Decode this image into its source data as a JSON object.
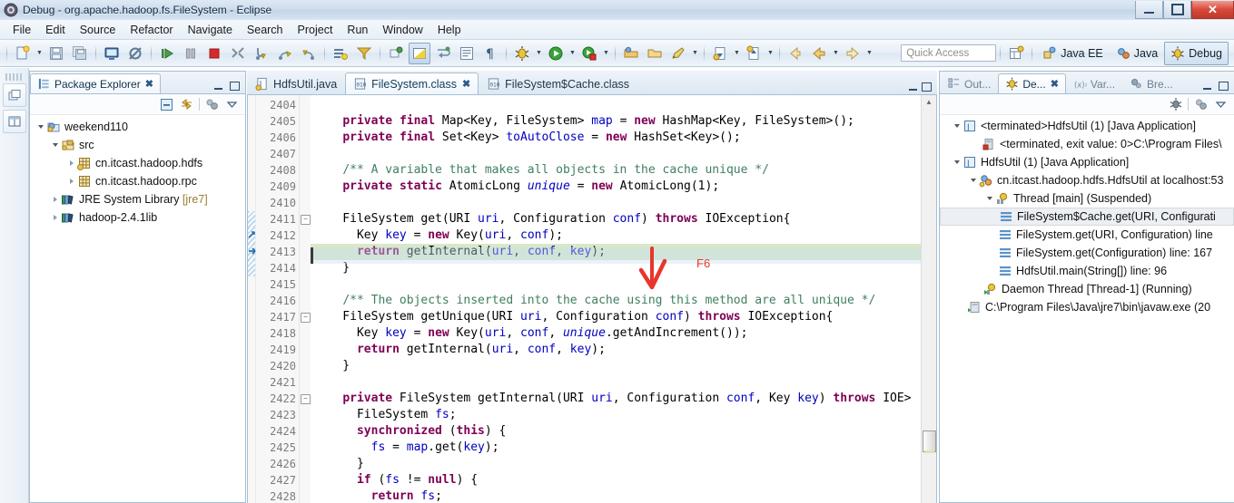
{
  "window": {
    "title": "Debug - org.apache.hadoop.fs.FileSystem - Eclipse",
    "app_icon": "eclipse-icon",
    "minimize_label": "–",
    "maximize_label": "❐",
    "close_label": "✕"
  },
  "menu": {
    "items": [
      "File",
      "Edit",
      "Source",
      "Refactor",
      "Navigate",
      "Search",
      "Project",
      "Run",
      "Window",
      "Help"
    ]
  },
  "toolbar": {
    "groups": [
      {
        "buttons": [
          {
            "name": "new-wizard-icon",
            "caret": true
          },
          {
            "name": "save-icon",
            "caret": false
          },
          {
            "name": "save-all-icon",
            "caret": false
          }
        ]
      },
      {
        "buttons": [
          {
            "name": "console-icon",
            "caret": false
          },
          {
            "name": "skip-breakpoints-icon",
            "caret": false
          }
        ]
      },
      {
        "buttons": [
          {
            "name": "resume-icon",
            "caret": false
          },
          {
            "name": "suspend-icon",
            "caret": false
          },
          {
            "name": "terminate-icon",
            "caret": false
          },
          {
            "name": "disconnect-icon",
            "caret": false
          },
          {
            "name": "step-into-icon",
            "caret": false
          },
          {
            "name": "step-over-icon",
            "caret": false
          },
          {
            "name": "step-return-icon",
            "caret": false
          }
        ]
      },
      {
        "buttons": [
          {
            "name": "drop-to-frame-icon",
            "caret": false
          },
          {
            "name": "use-step-filters-icon",
            "caret": false
          }
        ]
      },
      {
        "buttons": [
          {
            "name": "toggle-mark-occurrences-icon",
            "caret": false
          },
          {
            "name": "toggle-block-selection-icon",
            "caret": false
          },
          {
            "name": "toggle-word-wrap-icon",
            "caret": false
          },
          {
            "name": "show-whitespace-icon",
            "caret": false
          },
          {
            "name": "show-print-margin-icon",
            "caret": false
          }
        ]
      },
      {
        "buttons": [
          {
            "name": "debug-launch-icon",
            "caret": true
          },
          {
            "name": "run-launch-icon",
            "caret": true
          },
          {
            "name": "external-tools-icon",
            "caret": true
          }
        ]
      },
      {
        "buttons": [
          {
            "name": "open-type-icon",
            "caret": false
          },
          {
            "name": "open-task-icon",
            "caret": false
          },
          {
            "name": "new-java-class-icon",
            "caret": true
          }
        ]
      },
      {
        "buttons": [
          {
            "name": "previous-annotation-icon",
            "caret": true
          },
          {
            "name": "next-annotation-icon",
            "caret": true
          }
        ]
      },
      {
        "buttons": [
          {
            "name": "back-history-icon",
            "caret": false
          },
          {
            "name": "back-arrow-icon",
            "caret": true
          },
          {
            "name": "forward-arrow-icon",
            "caret": true
          }
        ]
      }
    ],
    "quick_access_placeholder": "Quick Access",
    "open-perspective-icon": "open-perspective-icon",
    "perspectives": [
      {
        "label": "Java EE",
        "icon": "java-ee-perspective-icon",
        "active": false
      },
      {
        "label": "Java",
        "icon": "java-perspective-icon",
        "active": false
      },
      {
        "label": "Debug",
        "icon": "debug-perspective-icon",
        "active": true
      }
    ]
  },
  "fastbar": {
    "buttons": [
      {
        "name": "restore-package-explorer-icon"
      },
      {
        "name": "restore-outline-icon"
      }
    ]
  },
  "package_explorer": {
    "tab_label": "Package Explorer",
    "tab_icon": "package-explorer-icon",
    "close_label": "✖",
    "minimize_label": "–",
    "maximize_label": "❐",
    "toolbar": [
      {
        "name": "collapse-all-icon"
      },
      {
        "name": "link-with-editor-icon"
      },
      {
        "name": "focus-on-active-task-icon"
      },
      {
        "name": "view-menu-icon"
      }
    ],
    "tree": [
      {
        "label": "weekend110",
        "indent": 0,
        "twist": "open",
        "icon": "java-project-icon"
      },
      {
        "label": "src",
        "indent": 1,
        "twist": "open",
        "icon": "source-folder-icon"
      },
      {
        "label": "cn.itcast.hadoop.hdfs",
        "indent": 2,
        "twist": "closed",
        "icon": "package-warning-icon"
      },
      {
        "label": "cn.itcast.hadoop.rpc",
        "indent": 2,
        "twist": "closed",
        "icon": "package-icon"
      },
      {
        "label": "JRE System Library",
        "suffix": " [jre7]",
        "indent": 1,
        "twist": "closed",
        "icon": "library-icon"
      },
      {
        "label": "hadoop-2.4.1lib",
        "indent": 1,
        "twist": "closed",
        "icon": "library-icon"
      }
    ]
  },
  "editor": {
    "tabs": [
      {
        "label": "HdfsUtil.java",
        "icon": "java-file-icon",
        "active": false,
        "closable": false
      },
      {
        "label": "FileSystem.class",
        "icon": "class-file-icon",
        "active": true,
        "closable": true
      },
      {
        "label": "FileSystem$Cache.class",
        "icon": "class-file-icon",
        "active": false,
        "closable": false
      }
    ],
    "close_label": "✖",
    "controls": [
      {
        "name": "minimize-editor-icon",
        "label": "–"
      },
      {
        "name": "maximize-editor-icon",
        "label": "❐"
      }
    ],
    "first_line_number": 2404,
    "highlight_line": 2413,
    "current_instruction_line": 2413,
    "lines": [
      {
        "n": 2404,
        "fold": false,
        "marker": "",
        "text": ""
      },
      {
        "n": 2405,
        "fold": false,
        "marker": "",
        "text": "    <k>private</k> <k>final</k> Map&lt;Key, FileSystem&gt; <f>map</f> = <k>new</k> HashMap&lt;Key, FileSystem&gt;();"
      },
      {
        "n": 2406,
        "fold": false,
        "marker": "",
        "text": "    <k>private</k> <k>final</k> Set&lt;Key&gt; <f>toAutoClose</f> = <k>new</k> HashSet&lt;Key&gt;();"
      },
      {
        "n": 2407,
        "fold": false,
        "marker": "",
        "text": ""
      },
      {
        "n": 2408,
        "fold": false,
        "marker": "",
        "text": "    <c>/** A variable that makes all objects in the cache unique */</c>"
      },
      {
        "n": 2409,
        "fold": false,
        "marker": "",
        "text": "    <k>private</k> <k>static</k> AtomicLong <i>unique</i> = <k>new</k> AtomicLong(1);"
      },
      {
        "n": 2410,
        "fold": false,
        "marker": "",
        "text": ""
      },
      {
        "n": 2411,
        "fold": true,
        "marker": "stack",
        "text": "    FileSystem get(URI <f>uri</f>, Configuration <f>conf</f>) <k>throws</k> IOException{"
      },
      {
        "n": 2412,
        "fold": false,
        "marker": "stack",
        "text": "      Key <f>key</f> = <k>new</k> Key(<f>uri</f>, <f>conf</f>);"
      },
      {
        "n": 2413,
        "fold": false,
        "marker": "current",
        "text": "      <k>return</k> getInternal(<f>uri</f>, <f>conf</f>, <f>key</f>);"
      },
      {
        "n": 2414,
        "fold": false,
        "marker": "",
        "text": "    }"
      },
      {
        "n": 2415,
        "fold": false,
        "marker": "",
        "text": ""
      },
      {
        "n": 2416,
        "fold": false,
        "marker": "",
        "text": "    <c>/** The objects inserted into the cache using this method are all unique */</c>"
      },
      {
        "n": 2417,
        "fold": true,
        "marker": "",
        "text": "    FileSystem getUnique(URI <f>uri</f>, Configuration <f>conf</f>) <k>throws</k> IOException{"
      },
      {
        "n": 2418,
        "fold": false,
        "marker": "",
        "text": "      Key <f>key</f> = <k>new</k> Key(<f>uri</f>, <f>conf</f>, <i>unique</i>.getAndIncrement());"
      },
      {
        "n": 2419,
        "fold": false,
        "marker": "",
        "text": "      <k>return</k> getInternal(<f>uri</f>, <f>conf</f>, <f>key</f>);"
      },
      {
        "n": 2420,
        "fold": false,
        "marker": "",
        "text": "    }"
      },
      {
        "n": 2421,
        "fold": false,
        "marker": "",
        "text": ""
      },
      {
        "n": 2422,
        "fold": true,
        "marker": "",
        "text": "    <k>private</k> FileSystem getInternal(URI <f>uri</f>, Configuration <f>conf</f>, Key <f>key</f>) <k>throws</k> IOE&gt;"
      },
      {
        "n": 2423,
        "fold": false,
        "marker": "",
        "text": "      FileSystem <f>fs</f>;"
      },
      {
        "n": 2424,
        "fold": false,
        "marker": "",
        "text": "      <k>synchronized</k> (<k>this</k>) {"
      },
      {
        "n": 2425,
        "fold": false,
        "marker": "",
        "text": "        <f>fs</f> = <f>map</f>.get(<f>key</f>);"
      },
      {
        "n": 2426,
        "fold": false,
        "marker": "",
        "text": "      }"
      },
      {
        "n": 2427,
        "fold": false,
        "marker": "",
        "text": "      <k>if</k> (<f>fs</f> != <k>null</k>) {"
      },
      {
        "n": 2428,
        "fold": false,
        "marker": "",
        "text": "        <k>return</k> <f>fs</f>;"
      }
    ],
    "annotation": {
      "label": "F6",
      "color": "#e8362b",
      "arrow_name": "red-down-arrow-annotation"
    }
  },
  "debug_view": {
    "tabs": [
      {
        "label": "Out...",
        "icon": "outline-icon",
        "active": false,
        "closable": false
      },
      {
        "label": "De...",
        "icon": "debug-icon",
        "active": true,
        "closable": true
      },
      {
        "label": "Var...",
        "icon": "variables-icon",
        "active": false,
        "closable": false
      },
      {
        "label": "Bre...",
        "icon": "breakpoints-icon",
        "active": false,
        "closable": false
      }
    ],
    "close_label": "✖",
    "minimize_label": "–",
    "maximize_label": "❐",
    "toolbar": [
      {
        "name": "debug-view-menu-icon"
      },
      {
        "name": "view-layout-icon"
      },
      {
        "name": "view-menu-chevron-icon"
      }
    ],
    "tree": [
      {
        "label": "<terminated>HdfsUtil (1) [Java Application]",
        "indent": 0,
        "twist": "open",
        "icon": "launch-terminated-icon",
        "selected": false
      },
      {
        "label": "<terminated, exit value: 0>C:\\Program Files\\",
        "indent": 2,
        "twist": "none",
        "icon": "process-terminated-icon",
        "selected": false
      },
      {
        "label": "HdfsUtil (1) [Java Application]",
        "indent": 0,
        "twist": "open",
        "icon": "launch-icon",
        "selected": false
      },
      {
        "label": "cn.itcast.hadoop.hdfs.HdfsUtil at localhost:53",
        "indent": 1,
        "twist": "open",
        "icon": "debug-target-icon",
        "selected": false
      },
      {
        "label": "Thread [main] (Suspended)",
        "indent": 2,
        "twist": "open",
        "icon": "thread-suspended-icon",
        "selected": false
      },
      {
        "label": "FileSystem$Cache.get(URI, Configurati",
        "indent": 3,
        "twist": "none",
        "icon": "stack-frame-icon",
        "selected": true
      },
      {
        "label": "FileSystem.get(URI, Configuration) line",
        "indent": 3,
        "twist": "none",
        "icon": "stack-frame-icon",
        "selected": false
      },
      {
        "label": "FileSystem.get(Configuration) line: 167",
        "indent": 3,
        "twist": "none",
        "icon": "stack-frame-icon",
        "selected": false
      },
      {
        "label": "HdfsUtil.main(String[]) line: 96",
        "indent": 3,
        "twist": "none",
        "icon": "stack-frame-icon",
        "selected": false
      },
      {
        "label": "Daemon Thread [Thread-1] (Running)",
        "indent": 2,
        "twist": "none",
        "icon": "thread-running-icon",
        "selected": false
      },
      {
        "label": "C:\\Program Files\\Java\\jre7\\bin\\javaw.exe (20",
        "indent": 1,
        "twist": "none",
        "icon": "process-icon",
        "selected": false
      }
    ]
  },
  "colors": {
    "title_bar": "#cfdded",
    "keyword": "#7f0055",
    "comment": "#3f7f5f",
    "field": "#0000c0",
    "highlight_line_bg": "#d8e8c8",
    "selection_row_bg": "#e8f0fa",
    "annotation_red": "#e8362b",
    "close_button": "#c0392b"
  }
}
